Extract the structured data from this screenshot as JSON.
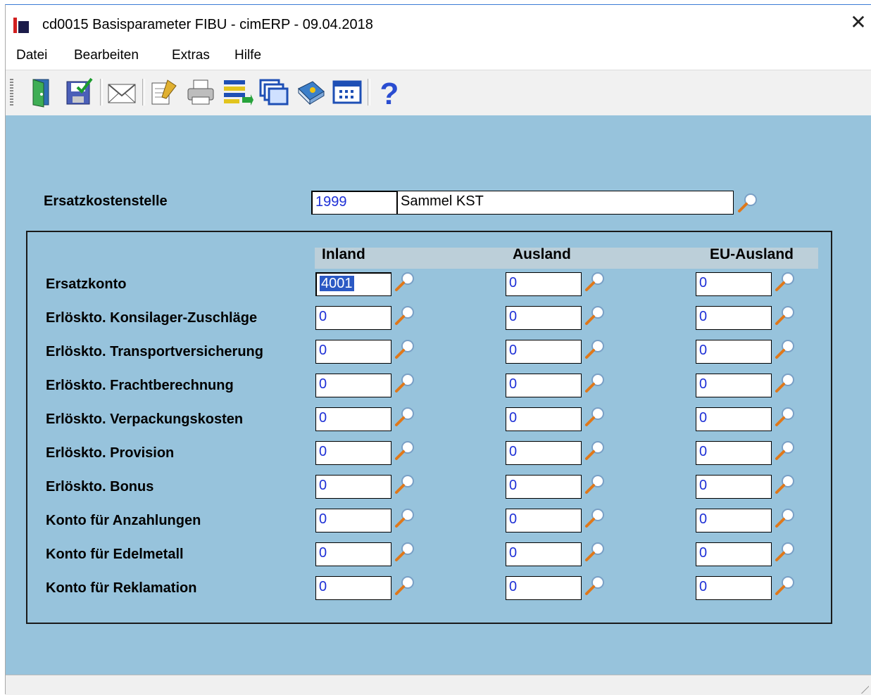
{
  "window": {
    "title": "cd0015 Basisparameter FIBU - cimERP - 09.04.2018",
    "close_symbol": "✕"
  },
  "menu": [
    "Datei",
    "Bearbeiten",
    "Extras",
    "Hilfe"
  ],
  "toolbar": {
    "icons": [
      "exit-door-icon",
      "save-icon",
      "mail-envelope-icon",
      "notes-pencil-icon",
      "printer-icon",
      "list-transfer-icon",
      "windows-cascade-icon",
      "book-icon",
      "table-grid-icon",
      "help-question-icon"
    ],
    "help_glyph": "?"
  },
  "form": {
    "ersatzkostenstelle": {
      "label": "Ersatzkostenstelle",
      "code": "1999",
      "name": "Sammel KST"
    },
    "columns": [
      "Inland",
      "Ausland",
      "EU-Ausland"
    ],
    "rows": [
      {
        "label": "Ersatzkonto",
        "values": [
          "4001",
          "0",
          "0"
        ]
      },
      {
        "label": "Erlöskto. Konsilager-Zuschläge",
        "values": [
          "0",
          "0",
          "0"
        ]
      },
      {
        "label": "Erlöskto. Transportversicherung",
        "values": [
          "0",
          "0",
          "0"
        ]
      },
      {
        "label": "Erlöskto. Frachtberechnung",
        "values": [
          "0",
          "0",
          "0"
        ]
      },
      {
        "label": "Erlöskto. Verpackungskosten",
        "values": [
          "0",
          "0",
          "0"
        ]
      },
      {
        "label": "Erlöskto. Provision",
        "values": [
          "0",
          "0",
          "0"
        ]
      },
      {
        "label": "Erlöskto. Bonus",
        "values": [
          "0",
          "0",
          "0"
        ]
      },
      {
        "label": "Konto für Anzahlungen",
        "values": [
          "0",
          "0",
          "0"
        ]
      },
      {
        "label": "Konto für Edelmetall",
        "values": [
          "0",
          "0",
          "0"
        ]
      },
      {
        "label": "Konto für Reklamation",
        "values": [
          "0",
          "0",
          "0"
        ]
      }
    ]
  },
  "colors": {
    "content_bg": "#97c3dc",
    "input_text": "#1d2fd6",
    "selection": "#2b59c4"
  }
}
